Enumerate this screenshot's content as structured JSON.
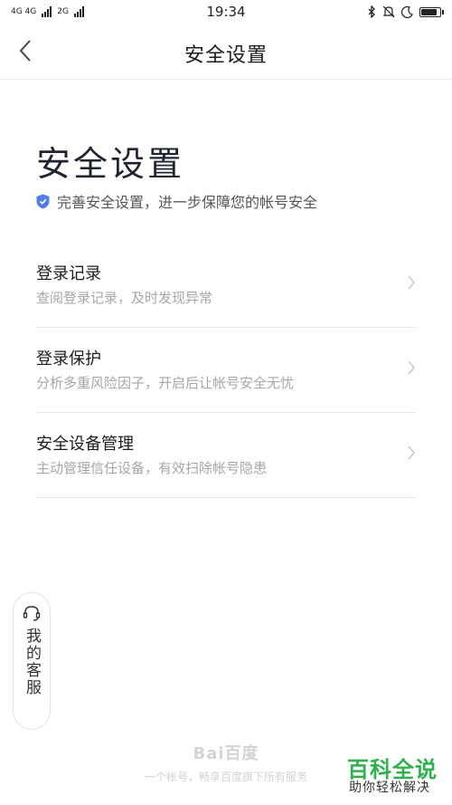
{
  "status_bar": {
    "network_left": "4G 4G",
    "network_right": "2G",
    "time": "19:34",
    "icons": [
      "bluetooth-icon",
      "mute-icon",
      "moon-icon",
      "battery-icon"
    ]
  },
  "nav": {
    "title": "安全设置",
    "back_icon": "back-arrow-icon"
  },
  "hero": {
    "title": "安全设置",
    "subtitle": "完善安全设置，进一步保障您的帐号安全",
    "shield_color": "#4e7fe8"
  },
  "list": {
    "items": [
      {
        "title": "登录记录",
        "desc": "查阅登录记录，及时发现异常"
      },
      {
        "title": "登录保护",
        "desc": "分析多重风险因子，开启后让帐号安全无忧"
      },
      {
        "title": "安全设备管理",
        "desc": "主动管理信任设备，有效扫除帐号隐患"
      }
    ]
  },
  "customer_service": {
    "label": "我的客服",
    "icon": "headset-icon"
  },
  "footer": {
    "logo": "Bai百度",
    "slogan": "一个帐号，畅享百度旗下所有服务"
  },
  "watermark": {
    "title": "百科全说",
    "subtitle": "助你轻松解决"
  }
}
